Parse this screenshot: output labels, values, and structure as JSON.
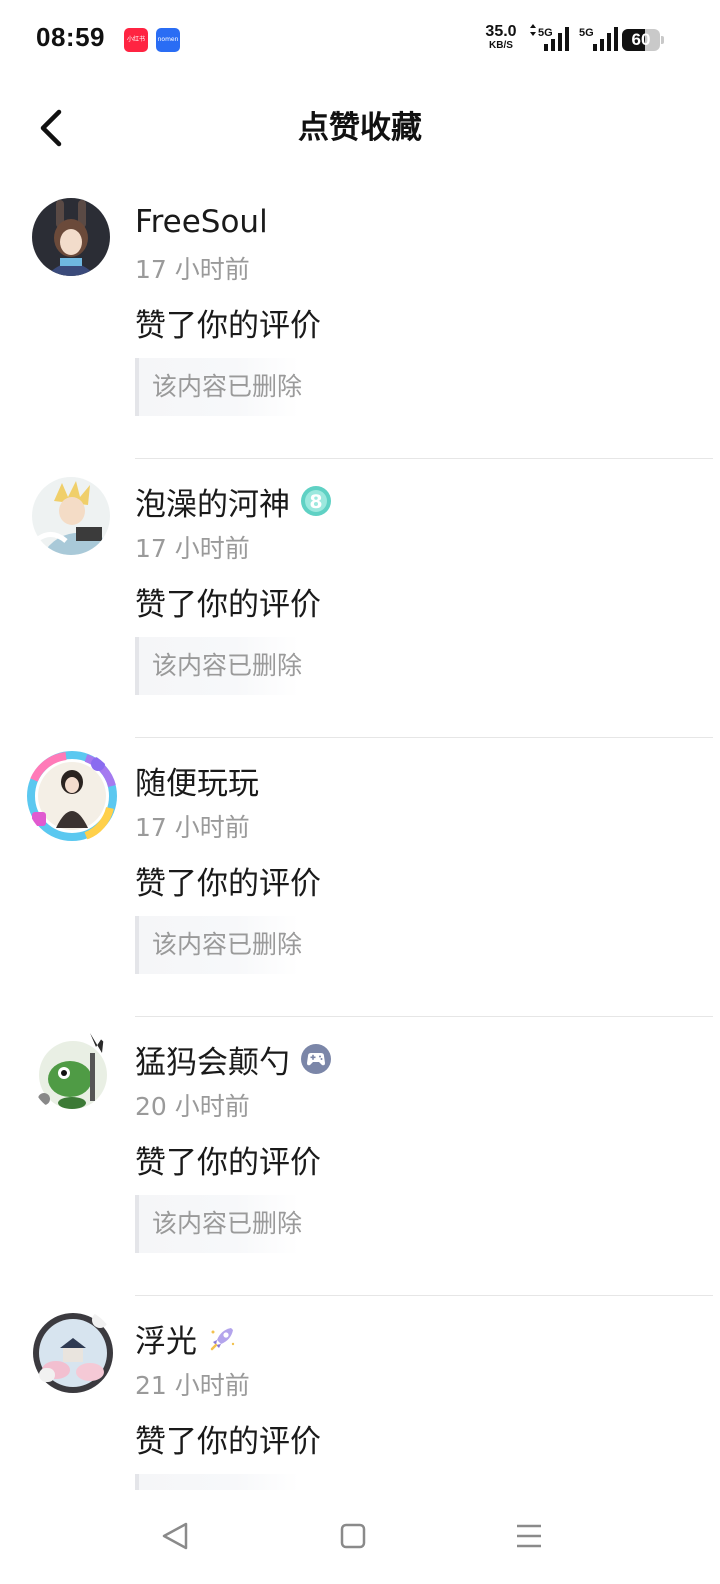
{
  "status_bar": {
    "time": "08:59",
    "app_badges": [
      {
        "label": "小红书",
        "color": "#ff2442"
      },
      {
        "label": "nomen",
        "color": "#2a6df4"
      }
    ],
    "network_speed": "35.0",
    "network_speed_unit": "KB/S",
    "signal_1_label": "5G",
    "signal_2_label": "5G",
    "battery_level": "60",
    "battery_fraction": 0.6
  },
  "header": {
    "title": "点赞收藏",
    "back_icon": "chevron-left-icon"
  },
  "notifications": [
    {
      "username": "FreeSoul",
      "time": "17 小时前",
      "action": "赞了你的评价",
      "ref_text": "该内容已删除",
      "badge": null
    },
    {
      "username": "泡澡的河神",
      "time": "17 小时前",
      "action": "赞了你的评价",
      "ref_text": "该内容已删除",
      "badge": "level-8-badge-icon"
    },
    {
      "username": "随便玩玩",
      "time": "17 小时前",
      "action": "赞了你的评价",
      "ref_text": "该内容已删除",
      "badge": null
    },
    {
      "username": "猛犸会颠勺",
      "time": "20 小时前",
      "action": "赞了你的评价",
      "ref_text": "该内容已删除",
      "badge": "gamepad-badge-icon"
    },
    {
      "username": "浮光",
      "time": "21 小时前",
      "action": "赞了你的评价",
      "ref_text": "",
      "badge": "rocket-badge-icon"
    }
  ],
  "colors": {
    "primary_text": "#1a1a1a",
    "secondary_text": "#9a9a9a",
    "divider": "#e6e6e6",
    "level_badge": "#5fd1c4",
    "gamepad_badge": "#7b86a8"
  },
  "nav_bar": {
    "back_icon": "triangle-back-icon",
    "home_icon": "square-home-icon",
    "menu_icon": "menu-lines-icon"
  }
}
